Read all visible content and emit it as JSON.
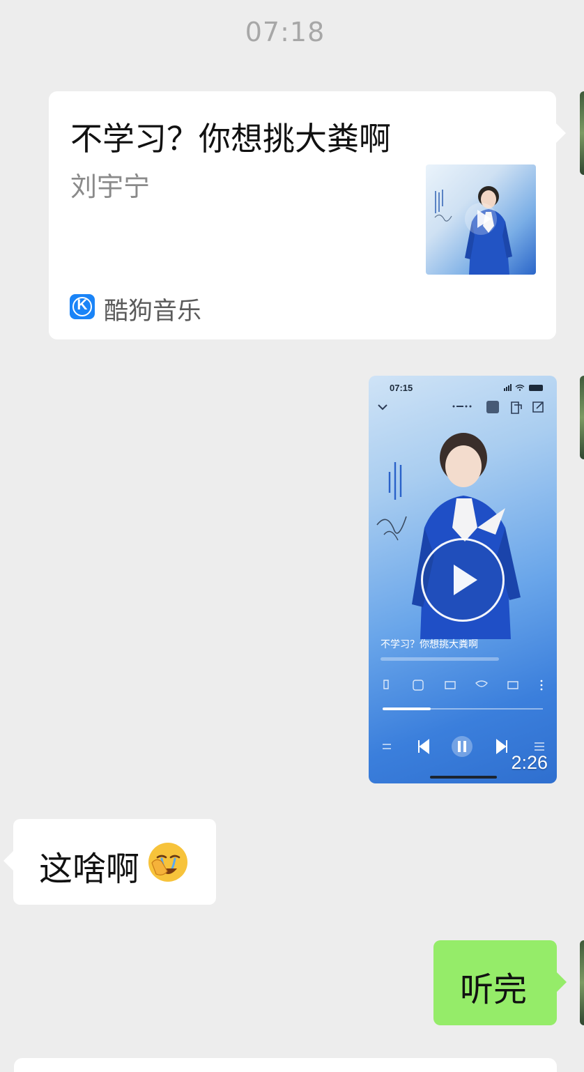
{
  "chat": {
    "timestamp": "07:18",
    "music_card": {
      "title": "不学习？你想挑大粪啊",
      "artist": "刘宇宁",
      "source": "酷狗音乐",
      "source_icon": "kugou-logo-icon",
      "source_icon_letter": "K",
      "source_color": "#1a84f7"
    },
    "video": {
      "status_time": "07:15",
      "song_title": "不学习？你想挑大粪啊",
      "duration": "2:26",
      "progress": 0.3
    },
    "received_message": {
      "text": "这啥啊",
      "emoji": "face-with-hand-over-mouth-crying-emoji"
    },
    "sent_message": {
      "text": "听完"
    }
  },
  "colors": {
    "background": "#ededed",
    "sent_bubble": "#95ec69",
    "received_bubble": "#ffffff",
    "timestamp": "#a7a7a7"
  }
}
